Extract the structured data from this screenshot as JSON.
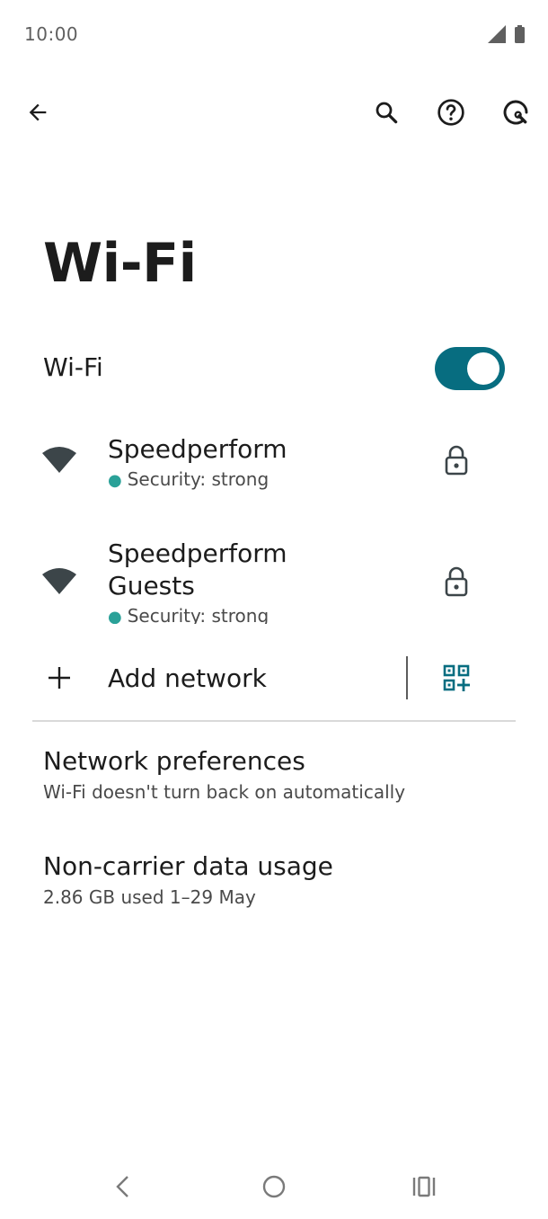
{
  "status_bar": {
    "time": "10:00"
  },
  "page": {
    "title": "Wi-Fi"
  },
  "wifi_toggle": {
    "label": "Wi-Fi",
    "state": "on"
  },
  "networks": [
    {
      "name": "Speedperform",
      "security": "Security: strong"
    },
    {
      "name": "Speedperform Guests",
      "security": "Security: strong"
    }
  ],
  "add_network": {
    "label": "Add network"
  },
  "preferences": [
    {
      "title": "Network preferences",
      "subtitle": "Wi-Fi doesn't turn back on automatically"
    },
    {
      "title": "Non-carrier data usage",
      "subtitle": "2.86 GB used 1–29 May"
    }
  ],
  "colors": {
    "accent": "#076d80",
    "security_dot": "#2aa198",
    "icon": "#3c4549"
  }
}
